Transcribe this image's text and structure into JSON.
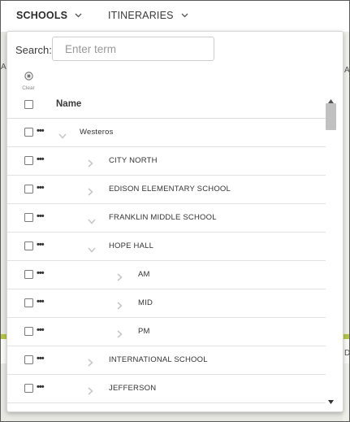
{
  "nav": {
    "tabs": [
      {
        "label": "SCHOOLS",
        "active": true
      },
      {
        "label": "ITINERARIES",
        "active": false
      }
    ]
  },
  "map": {
    "right_letter_top": "A",
    "left_letter_top": "A",
    "right_letter_bottom": "D"
  },
  "search": {
    "label": "Search:",
    "placeholder": "Enter term",
    "value": ""
  },
  "clear": {
    "label": "Clear",
    "icon": "clear-icon"
  },
  "tree": {
    "header": {
      "name": "Name"
    },
    "rows": [
      {
        "label": "Westeros",
        "expanded": true,
        "level": 0
      },
      {
        "label": "CITY NORTH",
        "expanded": false,
        "level": 1
      },
      {
        "label": "EDISON  ELEMENTARY SCHOOL",
        "expanded": false,
        "level": 1
      },
      {
        "label": "FRANKLIN MIDDLE SCHOOL",
        "expanded": true,
        "level": 1
      },
      {
        "label": "HOPE HALL",
        "expanded": true,
        "level": 1
      },
      {
        "label": "AM",
        "expanded": false,
        "level": 2
      },
      {
        "label": "MID",
        "expanded": false,
        "level": 2
      },
      {
        "label": "PM",
        "expanded": false,
        "level": 2
      },
      {
        "label": "INTERNATIONAL SCHOOL",
        "expanded": false,
        "level": 1
      },
      {
        "label": "JEFFERSON",
        "expanded": false,
        "level": 1
      }
    ],
    "more_glyph": "•••"
  },
  "colors": {
    "accent_green": "#b5c44a",
    "border": "#5a5a5a"
  }
}
